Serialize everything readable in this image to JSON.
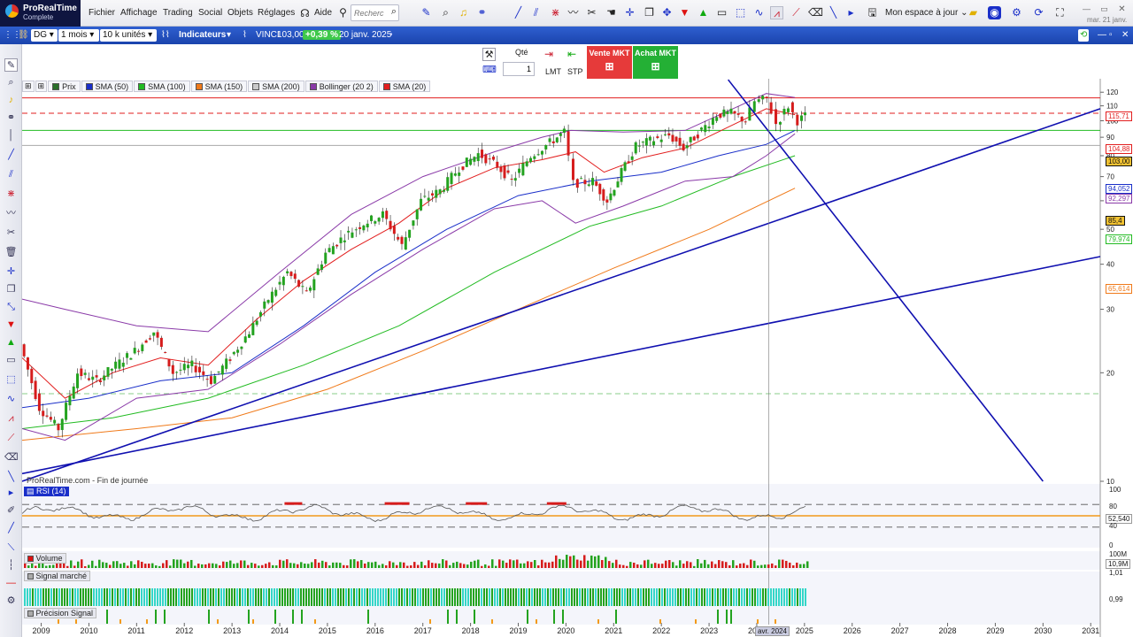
{
  "app": {
    "logo_line1": "ProRealTime",
    "logo_line2": "Complete"
  },
  "menu": [
    "Fichier",
    "Affichage",
    "Trading",
    "Social",
    "Objets",
    "Réglages",
    "Aide"
  ],
  "search": {
    "placeholder": "Recherc"
  },
  "workspace_label": "Mon espace à jour",
  "clock": "mar. 21 janv.",
  "toolbar2": {
    "symbol": "DG",
    "period": "1 mois",
    "units": "10 k unités",
    "indicators": "Indicateurs",
    "instrument": "VINCI",
    "last": "103,00",
    "change": "+0,39 %",
    "date": "20 janv. 2025"
  },
  "order": {
    "qty_label": "Qté",
    "qty_value": "1",
    "lmt": "LMT",
    "stp": "STP",
    "sell": "Vente MKT",
    "buy": "Achat MKT"
  },
  "legend": [
    {
      "label": "Prix",
      "color": "#2a6f2a"
    },
    {
      "label": "SMA (50)",
      "color": "#1a2fc9"
    },
    {
      "label": "SMA (100)",
      "color": "#22bb22"
    },
    {
      "label": "SMA (150)",
      "color": "#f07a1a"
    },
    {
      "label": "SMA (200)",
      "color": "#c9c9c9"
    },
    {
      "label": "Bollinger (20 2)",
      "color": "#8a3aa8"
    },
    {
      "label": "SMA (20)",
      "color": "#e21e1e"
    }
  ],
  "source_label": "ProRealTime.com - Fin de journée",
  "rsi_label": "RSI (14)",
  "volume_label": "Volume",
  "signal_label": "Signal marché",
  "precision_label": "Précision Signal",
  "price_tags": [
    {
      "text": "115,71",
      "color": "#e21e1e"
    },
    {
      "text": "104,88",
      "color": "#e21e1e"
    },
    {
      "text": "103,00",
      "color": "#111111",
      "bg": "#f1c232"
    },
    {
      "text": "94,052",
      "color": "#1a2fc9"
    },
    {
      "text": "92,297",
      "color": "#8a3aa8"
    },
    {
      "text": "85,4",
      "color": "#111111",
      "bg": "#f1c232"
    },
    {
      "text": "79,974",
      "color": "#22bb22"
    },
    {
      "text": "65,614",
      "color": "#f07a1a"
    }
  ],
  "rsi_tags": [
    "100",
    "80",
    "52,540",
    "40",
    "0"
  ],
  "volume_tags": [
    "100M",
    "10,9M"
  ],
  "signal_tags": [
    "1,01",
    "0,99"
  ],
  "crosshair_label": "avr. 2024",
  "chart_data": {
    "type": "candlestick",
    "title": "VINCI",
    "period": "1 mois",
    "y_scale": "log",
    "ylim": [
      10,
      125
    ],
    "y_ticks": [
      10,
      20,
      30,
      40,
      50,
      60,
      70,
      80,
      90,
      100,
      110,
      120
    ],
    "x_ticks": [
      "2009",
      "2010",
      "2011",
      "2012",
      "2013",
      "2014",
      "2015",
      "2016",
      "2017",
      "2018",
      "2019",
      "2020",
      "2021",
      "2022",
      "2023",
      "2024",
      "2025",
      "2026",
      "2027",
      "2028",
      "2029",
      "2030",
      "2031"
    ],
    "price_path": [
      [
        2008.6,
        24
      ],
      [
        2009.0,
        16
      ],
      [
        2009.4,
        14
      ],
      [
        2009.8,
        20
      ],
      [
        2010.2,
        19
      ],
      [
        2010.6,
        21
      ],
      [
        2011.0,
        23
      ],
      [
        2011.4,
        26
      ],
      [
        2011.8,
        20
      ],
      [
        2012.2,
        21
      ],
      [
        2012.6,
        19
      ],
      [
        2013.0,
        22
      ],
      [
        2013.4,
        26
      ],
      [
        2013.8,
        32
      ],
      [
        2014.2,
        38
      ],
      [
        2014.6,
        33
      ],
      [
        2015.0,
        43
      ],
      [
        2015.4,
        48
      ],
      [
        2015.8,
        52
      ],
      [
        2016.2,
        55
      ],
      [
        2016.6,
        45
      ],
      [
        2017.0,
        60
      ],
      [
        2017.4,
        64
      ],
      [
        2017.8,
        74
      ],
      [
        2018.2,
        81
      ],
      [
        2018.6,
        75
      ],
      [
        2018.9,
        68
      ],
      [
        2019.3,
        80
      ],
      [
        2019.7,
        87
      ],
      [
        2020.0,
        93
      ],
      [
        2020.2,
        67
      ],
      [
        2020.6,
        68
      ],
      [
        2020.9,
        60
      ],
      [
        2021.2,
        72
      ],
      [
        2021.5,
        85
      ],
      [
        2021.8,
        88
      ],
      [
        2022.2,
        91
      ],
      [
        2022.5,
        84
      ],
      [
        2022.8,
        92
      ],
      [
        2023.2,
        104
      ],
      [
        2023.5,
        105
      ],
      [
        2023.8,
        100
      ],
      [
        2024.0,
        113
      ],
      [
        2024.25,
        115
      ],
      [
        2024.45,
        98
      ],
      [
        2024.7,
        110
      ],
      [
        2024.9,
        100
      ],
      [
        2025.05,
        103
      ]
    ],
    "bollinger_upper": [
      [
        2008.6,
        32
      ],
      [
        2009.5,
        30
      ],
      [
        2011.0,
        27
      ],
      [
        2012.5,
        26
      ],
      [
        2014.0,
        38
      ],
      [
        2015.5,
        55
      ],
      [
        2017.0,
        70
      ],
      [
        2018.5,
        82
      ],
      [
        2019.5,
        90
      ],
      [
        2020.1,
        94
      ],
      [
        2021.2,
        93
      ],
      [
        2022.5,
        94
      ],
      [
        2023.5,
        108
      ],
      [
        2024.2,
        119
      ],
      [
        2024.8,
        116
      ]
    ],
    "bollinger_lower": [
      [
        2008.6,
        14
      ],
      [
        2009.5,
        13
      ],
      [
        2011.0,
        17
      ],
      [
        2012.5,
        18
      ],
      [
        2014.0,
        24
      ],
      [
        2015.5,
        33
      ],
      [
        2017.0,
        44
      ],
      [
        2018.5,
        57
      ],
      [
        2019.5,
        60
      ],
      [
        2020.2,
        52
      ],
      [
        2021.2,
        58
      ],
      [
        2022.5,
        68
      ],
      [
        2023.5,
        70
      ],
      [
        2024.2,
        80
      ],
      [
        2024.8,
        92
      ]
    ],
    "sma20": [
      [
        2008.6,
        22
      ],
      [
        2009.5,
        17
      ],
      [
        2010.5,
        20
      ],
      [
        2011.5,
        22
      ],
      [
        2012.5,
        21
      ],
      [
        2013.5,
        28
      ],
      [
        2014.5,
        36
      ],
      [
        2015.5,
        44
      ],
      [
        2016.5,
        52
      ],
      [
        2017.5,
        65
      ],
      [
        2018.5,
        74
      ],
      [
        2019.5,
        78
      ],
      [
        2020.2,
        82
      ],
      [
        2020.8,
        72
      ],
      [
        2021.6,
        79
      ],
      [
        2022.5,
        84
      ],
      [
        2023.4,
        96
      ],
      [
        2024.2,
        108
      ],
      [
        2024.8,
        104
      ]
    ],
    "sma50": [
      [
        2008.6,
        16
      ],
      [
        2010.0,
        17
      ],
      [
        2011.5,
        19
      ],
      [
        2013.0,
        20
      ],
      [
        2014.5,
        27
      ],
      [
        2016.0,
        38
      ],
      [
        2017.5,
        50
      ],
      [
        2019.0,
        62
      ],
      [
        2020.5,
        68
      ],
      [
        2022.0,
        72
      ],
      [
        2023.2,
        80
      ],
      [
        2024.2,
        86
      ],
      [
        2024.8,
        94
      ]
    ],
    "sma100": [
      [
        2008.6,
        14
      ],
      [
        2010.5,
        15
      ],
      [
        2012.5,
        17
      ],
      [
        2014.5,
        21
      ],
      [
        2016.5,
        27
      ],
      [
        2018.5,
        38
      ],
      [
        2020.5,
        51
      ],
      [
        2022.0,
        58
      ],
      [
        2023.5,
        70
      ],
      [
        2024.8,
        80
      ]
    ],
    "sma150": [
      [
        2008.6,
        13
      ],
      [
        2011.0,
        14
      ],
      [
        2013.0,
        15
      ],
      [
        2015.0,
        18
      ],
      [
        2017.0,
        23
      ],
      [
        2019.0,
        30
      ],
      [
        2021.0,
        39
      ],
      [
        2023.0,
        50
      ],
      [
        2024.8,
        65
      ]
    ],
    "trendlines": [
      {
        "from": [
          2008.6,
          10
        ],
        "to": [
          2031.2,
          108
        ],
        "color": "#1010b0"
      },
      {
        "from": [
          2008.6,
          10.5
        ],
        "to": [
          2031.2,
          42
        ],
        "color": "#1010b0"
      },
      {
        "from": [
          2023.4,
          130
        ],
        "to": [
          2030.0,
          10
        ],
        "color": "#1010b0"
      }
    ],
    "hlines": [
      {
        "y": 115.71,
        "color": "#e21e1e",
        "dash": false
      },
      {
        "y": 104.88,
        "color": "#e21e1e",
        "dash": true
      },
      {
        "y": 94.05,
        "color": "#22bb22",
        "dash": false
      },
      {
        "y": 85.4,
        "color": "#aaaaaa",
        "dash": false
      },
      {
        "y": 17.5,
        "color": "#88cc88",
        "dash": true
      }
    ],
    "crosshair_x": 2024.25,
    "rsi": {
      "ylim": [
        0,
        100
      ],
      "levels": [
        70,
        50,
        30
      ],
      "last": 52.54
    },
    "volume": {
      "last": "10,9M",
      "scale_max": "100M"
    }
  }
}
